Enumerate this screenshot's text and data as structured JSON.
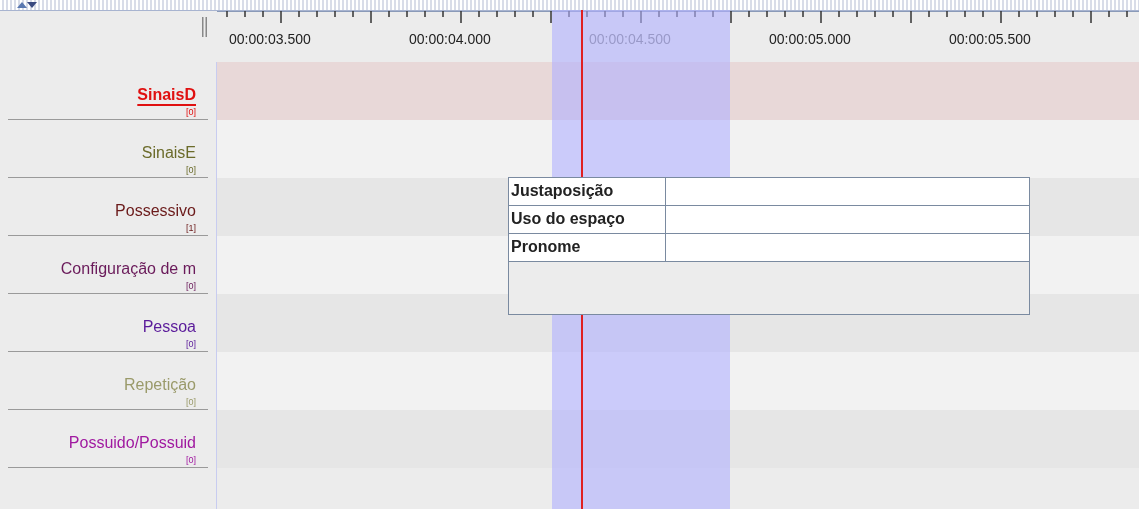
{
  "ruler": {
    "labels": [
      {
        "text": "00:00:03.500",
        "in_selection": false
      },
      {
        "text": "00:00:04.000",
        "in_selection": false
      },
      {
        "text": "00:00:04.500",
        "in_selection": true
      },
      {
        "text": "00:00:05.000",
        "in_selection": false
      },
      {
        "text": "00:00:05.500",
        "in_selection": false
      }
    ]
  },
  "tiers": [
    {
      "name": "SinaisD",
      "count": "[0]",
      "color": "#e01010",
      "selected": true
    },
    {
      "name": "SinaisE",
      "count": "[0]",
      "color": "#6b6b2a",
      "selected": false
    },
    {
      "name": "Possessivo",
      "count": "[1]",
      "color": "#6b1a1a",
      "selected": false
    },
    {
      "name": "Configuração de m",
      "count": "[0]",
      "color": "#6a1a5a",
      "selected": false
    },
    {
      "name": "Pessoa",
      "count": "[0]",
      "color": "#5a1a9a",
      "selected": false
    },
    {
      "name": "Repetição",
      "count": "[0]",
      "color": "#9a9a6a",
      "selected": false
    },
    {
      "name": "Possuido/Possuid",
      "count": "[0]",
      "color": "#a01aa0",
      "selected": false
    }
  ],
  "popup": {
    "rows": [
      {
        "label": "Justaposição"
      },
      {
        "label": "Uso do espaço"
      },
      {
        "label": "Pronome"
      }
    ]
  }
}
